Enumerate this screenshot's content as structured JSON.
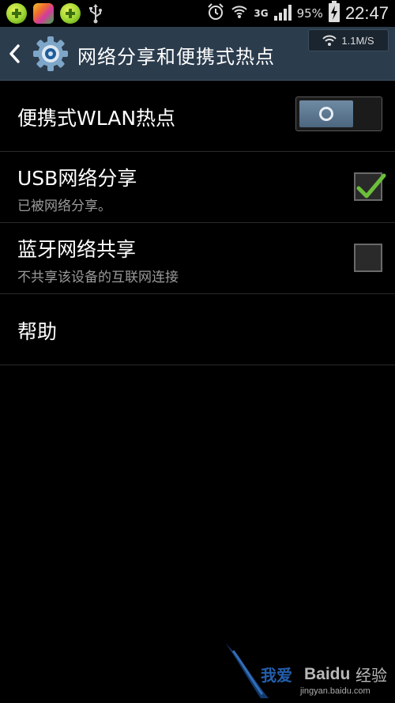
{
  "status_bar": {
    "network_label": "3G",
    "battery_percent": "95%",
    "time": "22:47",
    "icons": [
      "green-app-icon",
      "multicolor-app-icon",
      "green-app-icon",
      "usb-icon",
      "alarm-icon",
      "wifi-hotspot-icon",
      "signal-icon",
      "battery-charging-icon"
    ]
  },
  "action_bar": {
    "title": "网络分享和便携式热点",
    "speed": "1.1M/S"
  },
  "settings": {
    "wlan_hotspot": {
      "title": "便携式WLAN热点",
      "enabled": false
    },
    "usb_tethering": {
      "title": "USB网络分享",
      "subtitle": "已被网络分享。",
      "checked": true
    },
    "bluetooth_tethering": {
      "title": "蓝牙网络共享",
      "subtitle": "不共享该设备的互联网连接",
      "checked": false
    },
    "help": {
      "title": "帮助"
    }
  },
  "watermark": {
    "text1": "我爱",
    "brand": "Baidu",
    "text2": "经验",
    "url": "jingyan.baidu.com"
  },
  "colors": {
    "action_bar_bg": "#2b3c4d",
    "check_green": "#6bbf3a",
    "background": "#000000"
  }
}
